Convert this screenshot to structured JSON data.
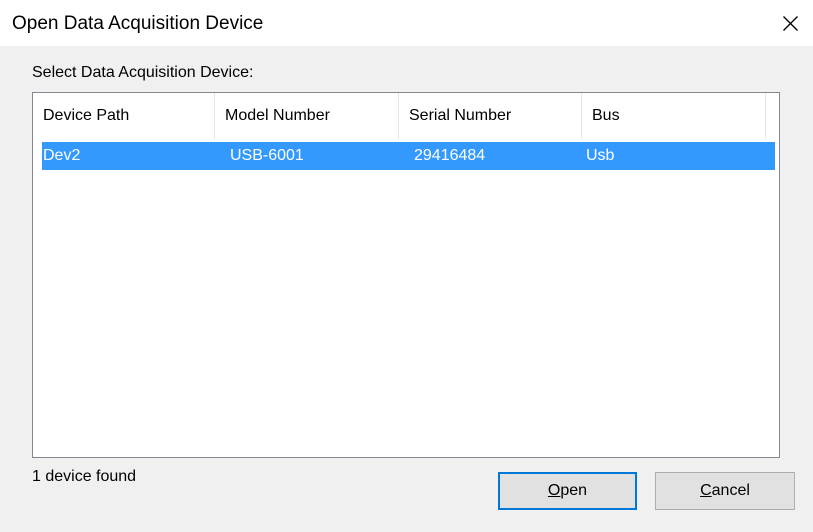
{
  "window": {
    "title": "Open Data Acquisition Device"
  },
  "dialog": {
    "group_label": "Select Data Acquisition Device:",
    "status": "1 device found"
  },
  "listview": {
    "columns": [
      {
        "label": "Device Path"
      },
      {
        "label": "Model Number"
      },
      {
        "label": "Serial Number"
      },
      {
        "label": "Bus"
      }
    ],
    "rows": [
      {
        "device_path": "Dev2",
        "model_number": "USB-6001",
        "serial_number": "29416484",
        "bus": "Usb",
        "selected": true
      }
    ]
  },
  "buttons": {
    "open": {
      "accel": "O",
      "rest": "pen"
    },
    "cancel": {
      "accel": "C",
      "rest": "ancel"
    }
  },
  "colors": {
    "selection": "#3399ff",
    "default_button_border": "#0078d7",
    "dialog_background": "#f0f0f0"
  },
  "icons": {
    "close": "close-icon"
  }
}
